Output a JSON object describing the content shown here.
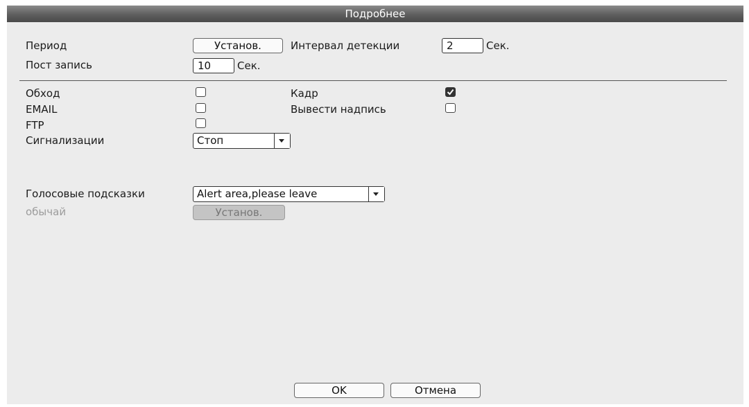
{
  "window": {
    "title": "Подробнее"
  },
  "period": {
    "label": "Период",
    "button": "Установ."
  },
  "detection_interval": {
    "label": "Интервал детекции",
    "value": "2",
    "unit": "Сек."
  },
  "post_record": {
    "label": "Пост запись",
    "value": "10",
    "unit": "Сек."
  },
  "options": {
    "tour": {
      "label": "Обход",
      "checked": false
    },
    "snapshot": {
      "label": "Кадр",
      "checked": true
    },
    "email": {
      "label": "EMAIL",
      "checked": false
    },
    "show_message": {
      "label": "Вывести надпись",
      "checked": false
    },
    "ftp": {
      "label": "FTP",
      "checked": false
    }
  },
  "alarm": {
    "label": "Сигнализации",
    "value": "Стоп"
  },
  "voice_prompt": {
    "label": "Голосовые подсказки",
    "value": "Alert area,please leave"
  },
  "custom": {
    "label": "обычай",
    "button": "Установ."
  },
  "footer": {
    "ok": "OK",
    "cancel": "Отмена"
  }
}
